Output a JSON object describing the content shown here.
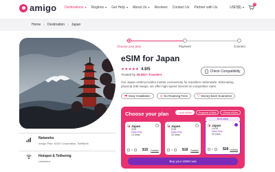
{
  "brand": {
    "name": "amigo",
    "accent": "#e8326f",
    "purple": "#7a2bb8"
  },
  "nav": {
    "items": [
      "Destinations",
      "Regions",
      "Get Help",
      "About Us",
      "Reviews",
      "Contact Us",
      "Partner with Us"
    ],
    "currency": "USD($)",
    "cart_count": "0"
  },
  "breadcrumb": {
    "items": [
      "Home",
      "Destination",
      "Japan"
    ]
  },
  "steps": [
    "Choose your plan",
    "Payment",
    "Connect"
  ],
  "product": {
    "title": "eSIM for Japan",
    "rating": "4.9/5",
    "trusted_prefix": "Trusted by",
    "trusted_count": "28,082+ Travelers",
    "check_button": "Check Compatibility",
    "description": "Our Japan eSIM provides instant connectivity for travellers nationwide. Eliminating physical SIM swaps, we offer high-speed internet at competitive rates.",
    "chips": [
      "Easy Installation",
      "No Roaming Fees",
      "Money-back Guarantee"
    ]
  },
  "plans": {
    "title": "Choose your plan",
    "tabs": [
      "Local eSIMs",
      "Regional eSIMs",
      "Global eSIMs"
    ],
    "best_label": "Best value",
    "cards": [
      {
        "name": "Japan",
        "data": "3GB",
        "type": "Data Only",
        "days": "14 Days",
        "qty": "1",
        "price": "$15",
        "details": "Details"
      },
      {
        "name": "Japan",
        "data": "5GB",
        "type": "Data Only",
        "days": "30 Days",
        "qty": "1",
        "price": "$18",
        "details": "Details"
      },
      {
        "name": "Japan",
        "data": "10GB",
        "type": "Data Only",
        "days": "30 Days",
        "qty": "1",
        "price": "$28",
        "details": "Details"
      }
    ],
    "buy_button": "Buy your eSIM now"
  },
  "features": [
    {
      "title": "Networks",
      "subtitle": "Amigo Plan: KDDI Corporation, SoftBank",
      "icon": "network-icon"
    },
    {
      "title": "Hotspot & Tethering",
      "subtitle": "Unlimited",
      "icon": "hotspot-icon"
    }
  ]
}
